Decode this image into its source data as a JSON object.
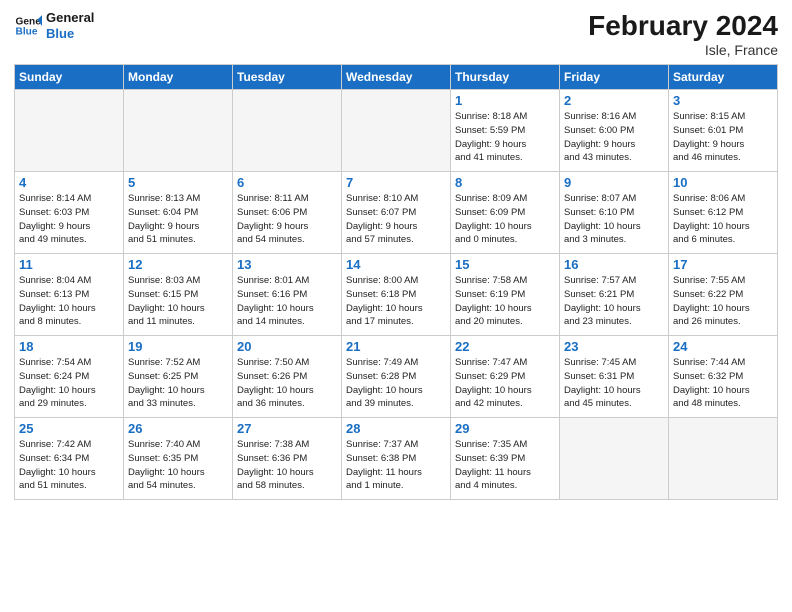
{
  "header": {
    "logo_line1": "General",
    "logo_line2": "Blue",
    "month": "February 2024",
    "location": "Isle, France"
  },
  "days_of_week": [
    "Sunday",
    "Monday",
    "Tuesday",
    "Wednesday",
    "Thursday",
    "Friday",
    "Saturday"
  ],
  "weeks": [
    [
      {
        "num": "",
        "info": ""
      },
      {
        "num": "",
        "info": ""
      },
      {
        "num": "",
        "info": ""
      },
      {
        "num": "",
        "info": ""
      },
      {
        "num": "1",
        "info": "Sunrise: 8:18 AM\nSunset: 5:59 PM\nDaylight: 9 hours\nand 41 minutes."
      },
      {
        "num": "2",
        "info": "Sunrise: 8:16 AM\nSunset: 6:00 PM\nDaylight: 9 hours\nand 43 minutes."
      },
      {
        "num": "3",
        "info": "Sunrise: 8:15 AM\nSunset: 6:01 PM\nDaylight: 9 hours\nand 46 minutes."
      }
    ],
    [
      {
        "num": "4",
        "info": "Sunrise: 8:14 AM\nSunset: 6:03 PM\nDaylight: 9 hours\nand 49 minutes."
      },
      {
        "num": "5",
        "info": "Sunrise: 8:13 AM\nSunset: 6:04 PM\nDaylight: 9 hours\nand 51 minutes."
      },
      {
        "num": "6",
        "info": "Sunrise: 8:11 AM\nSunset: 6:06 PM\nDaylight: 9 hours\nand 54 minutes."
      },
      {
        "num": "7",
        "info": "Sunrise: 8:10 AM\nSunset: 6:07 PM\nDaylight: 9 hours\nand 57 minutes."
      },
      {
        "num": "8",
        "info": "Sunrise: 8:09 AM\nSunset: 6:09 PM\nDaylight: 10 hours\nand 0 minutes."
      },
      {
        "num": "9",
        "info": "Sunrise: 8:07 AM\nSunset: 6:10 PM\nDaylight: 10 hours\nand 3 minutes."
      },
      {
        "num": "10",
        "info": "Sunrise: 8:06 AM\nSunset: 6:12 PM\nDaylight: 10 hours\nand 6 minutes."
      }
    ],
    [
      {
        "num": "11",
        "info": "Sunrise: 8:04 AM\nSunset: 6:13 PM\nDaylight: 10 hours\nand 8 minutes."
      },
      {
        "num": "12",
        "info": "Sunrise: 8:03 AM\nSunset: 6:15 PM\nDaylight: 10 hours\nand 11 minutes."
      },
      {
        "num": "13",
        "info": "Sunrise: 8:01 AM\nSunset: 6:16 PM\nDaylight: 10 hours\nand 14 minutes."
      },
      {
        "num": "14",
        "info": "Sunrise: 8:00 AM\nSunset: 6:18 PM\nDaylight: 10 hours\nand 17 minutes."
      },
      {
        "num": "15",
        "info": "Sunrise: 7:58 AM\nSunset: 6:19 PM\nDaylight: 10 hours\nand 20 minutes."
      },
      {
        "num": "16",
        "info": "Sunrise: 7:57 AM\nSunset: 6:21 PM\nDaylight: 10 hours\nand 23 minutes."
      },
      {
        "num": "17",
        "info": "Sunrise: 7:55 AM\nSunset: 6:22 PM\nDaylight: 10 hours\nand 26 minutes."
      }
    ],
    [
      {
        "num": "18",
        "info": "Sunrise: 7:54 AM\nSunset: 6:24 PM\nDaylight: 10 hours\nand 29 minutes."
      },
      {
        "num": "19",
        "info": "Sunrise: 7:52 AM\nSunset: 6:25 PM\nDaylight: 10 hours\nand 33 minutes."
      },
      {
        "num": "20",
        "info": "Sunrise: 7:50 AM\nSunset: 6:26 PM\nDaylight: 10 hours\nand 36 minutes."
      },
      {
        "num": "21",
        "info": "Sunrise: 7:49 AM\nSunset: 6:28 PM\nDaylight: 10 hours\nand 39 minutes."
      },
      {
        "num": "22",
        "info": "Sunrise: 7:47 AM\nSunset: 6:29 PM\nDaylight: 10 hours\nand 42 minutes."
      },
      {
        "num": "23",
        "info": "Sunrise: 7:45 AM\nSunset: 6:31 PM\nDaylight: 10 hours\nand 45 minutes."
      },
      {
        "num": "24",
        "info": "Sunrise: 7:44 AM\nSunset: 6:32 PM\nDaylight: 10 hours\nand 48 minutes."
      }
    ],
    [
      {
        "num": "25",
        "info": "Sunrise: 7:42 AM\nSunset: 6:34 PM\nDaylight: 10 hours\nand 51 minutes."
      },
      {
        "num": "26",
        "info": "Sunrise: 7:40 AM\nSunset: 6:35 PM\nDaylight: 10 hours\nand 54 minutes."
      },
      {
        "num": "27",
        "info": "Sunrise: 7:38 AM\nSunset: 6:36 PM\nDaylight: 10 hours\nand 58 minutes."
      },
      {
        "num": "28",
        "info": "Sunrise: 7:37 AM\nSunset: 6:38 PM\nDaylight: 11 hours\nand 1 minute."
      },
      {
        "num": "29",
        "info": "Sunrise: 7:35 AM\nSunset: 6:39 PM\nDaylight: 11 hours\nand 4 minutes."
      },
      {
        "num": "",
        "info": ""
      },
      {
        "num": "",
        "info": ""
      }
    ]
  ]
}
